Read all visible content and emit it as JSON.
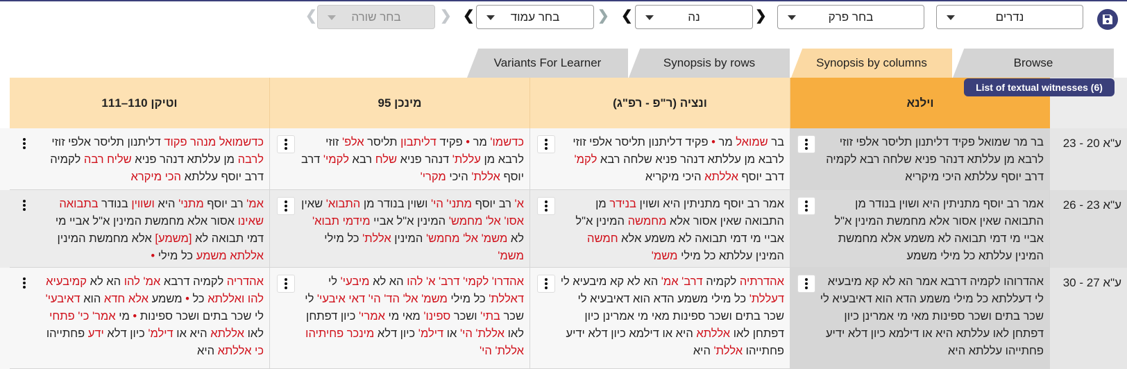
{
  "toolbar": {
    "save_icon": "save-icon",
    "tractate": "נדרים",
    "chapter_placeholder": "בחר פרק",
    "chapter_value": "נה",
    "page_placeholder": "בחר עמוד",
    "line_placeholder": "בחר שורה"
  },
  "tabs": {
    "browse": "Browse",
    "synopsis_columns": "Synopsis by columns",
    "synopsis_rows": "Synopsis by rows",
    "variants": "Variants For Learner"
  },
  "witness_button": "List of textual witnesses (6)",
  "columns": {
    "vilna": "וילנא",
    "venice": "ונציה (ר\"פ - רפ\"ג)",
    "munich": "מינכן 95",
    "vatican": "וטיקן 110–111"
  },
  "rows": [
    {
      "ref": "ע\"א 20 - 23",
      "vilna": [
        {
          "t": "בר מר שמואל פקיד דליתנון תליסר אלפי זוזי לרבא מן עללתא דנהר פניא שלחה רבא לקמיה דרב יוסף עללתא היכי מיקריא"
        }
      ],
      "venice": [
        {
          "t": "בר "
        },
        {
          "t": "שמואל",
          "v": true
        },
        {
          "t": " מר "
        },
        {
          "t": "•",
          "v": true
        },
        {
          "t": " פקיד דליתנון תליסר אלפי זוזי לרבא מן עללתא דנהר פניא שלחה רבא "
        },
        {
          "t": "לקמ'",
          "v": true
        },
        {
          "t": " דרב יוסף "
        },
        {
          "t": "אללתא",
          "v": true
        },
        {
          "t": " היכי מיקריא"
        }
      ],
      "munich": [
        {
          "t": "כדשמו'",
          "v": true
        },
        {
          "t": " מר "
        },
        {
          "t": "•",
          "v": true
        },
        {
          "t": " פקיד "
        },
        {
          "t": "דליתבון",
          "v": true
        },
        {
          "t": " תליסר "
        },
        {
          "t": "אלפ'",
          "v": true
        },
        {
          "t": " זוזי לרבא מן "
        },
        {
          "t": "עללת'",
          "v": true
        },
        {
          "t": " דנהר פניא "
        },
        {
          "t": "שלח",
          "v": true
        },
        {
          "t": " רבא "
        },
        {
          "t": "לקמי'",
          "v": true
        },
        {
          "t": " דרב יוסף "
        },
        {
          "t": "אללת'",
          "v": true
        },
        {
          "t": " היכי "
        },
        {
          "t": "מקרי'",
          "v": true
        }
      ],
      "vatican": [
        {
          "t": "כדשמואל מנהר פקוד",
          "v": true
        },
        {
          "t": " דליתנון תליסר אלפי זוזי "
        },
        {
          "t": "לרבה",
          "v": true
        },
        {
          "t": " מן עללתא דנהר פניא "
        },
        {
          "t": "שליח רבה",
          "v": true
        },
        {
          "t": " לקמיה דרב יוסף עללתא "
        },
        {
          "t": "הכי מיקרא",
          "v": true
        }
      ]
    },
    {
      "ref": "ע\"א 23 - 26",
      "vilna": [
        {
          "t": "אמר רב יוסף מתניתין היא ושוין בנודר מן התבואה שאין אסור אלא מחמשת המינין א\"ל אביי מי דמי תבואה לא משמע אלא מחמשת המינין עללתא כל מילי משמע"
        }
      ],
      "venice": [
        {
          "t": "אמר רב יוסף מתניתין היא ושוין "
        },
        {
          "t": "בנידר",
          "v": true
        },
        {
          "t": " מן התבואה שאין אסור אלא "
        },
        {
          "t": "מחמשה",
          "v": true
        },
        {
          "t": " המינין א\"ל אביי מי דמי תבואה לא משמע אלא "
        },
        {
          "t": "חמשה",
          "v": true
        },
        {
          "t": " המינין עללתא כל מילי "
        },
        {
          "t": "משמ'",
          "v": true
        }
      ],
      "munich": [
        {
          "t": "א'",
          "v": true
        },
        {
          "t": " רב יוסף "
        },
        {
          "t": "מתני' הי'",
          "v": true
        },
        {
          "t": " ושוין בנודר מן "
        },
        {
          "t": "התבוא'",
          "v": true
        },
        {
          "t": " שאין "
        },
        {
          "t": "אסו' אל' מחמש'",
          "v": true
        },
        {
          "t": " המינין א\"ל אביי "
        },
        {
          "t": "מידמי תבוא'",
          "v": true
        },
        {
          "t": " לא "
        },
        {
          "t": "משמ' אל' מחמש'",
          "v": true
        },
        {
          "t": " המינין "
        },
        {
          "t": "אללת'",
          "v": true
        },
        {
          "t": " כל מילי "
        },
        {
          "t": "משמ'",
          "v": true
        }
      ],
      "vatican": [
        {
          "t": "אמ'",
          "v": true
        },
        {
          "t": " רב יוסף "
        },
        {
          "t": "מתני'",
          "v": true
        },
        {
          "t": " היא "
        },
        {
          "t": "ושווין",
          "v": true
        },
        {
          "t": " בנודר "
        },
        {
          "t": "בתבואה שאינו",
          "v": true
        },
        {
          "t": " אסור אלא מחמשת המינין א\"ל אביי מי דמי תבואה לא "
        },
        {
          "t": "[משמע]",
          "v": true
        },
        {
          "t": " אלא מחמשת המינין "
        },
        {
          "t": "אללתא משמע",
          "v": true
        },
        {
          "t": " כל מילי "
        },
        {
          "t": "•",
          "v": true
        }
      ]
    },
    {
      "ref": "ע\"א 27 - 30",
      "vilna": [
        {
          "t": "אהדרוהו לקמיה דרבא אמר הא לא קא מיבעיא לי דעללתא כל מילי משמע הדא הוא דאיבעיא לי שכר בתים ושכר ספינות מאי מי אמרינן כיון דפתחן לאו עללתא היא או דילמא כיון דלא ידיע פחתייהו עללתא היא"
        }
      ],
      "venice": [
        {
          "t": "אהדרתיה",
          "v": true
        },
        {
          "t": " לקמיה "
        },
        {
          "t": "דרב' אמ'",
          "v": true
        },
        {
          "t": " הא לא קא מיבעיא לי "
        },
        {
          "t": "דעללת'",
          "v": true
        },
        {
          "t": " כל מילי משמע הדא הוא דאיבעיא לי שכר בתים ושכר ספינות מאי מי אמרינן כיון דפתחן לאו "
        },
        {
          "t": "אללתא",
          "v": true
        },
        {
          "t": " היא או דילמא כיון דלא ידיע פחתייהו "
        },
        {
          "t": "אללת'",
          "v": true
        },
        {
          "t": " היא"
        }
      ],
      "munich": [
        {
          "t": "אהדרו' לקמי' דרב' א' להו",
          "v": true
        },
        {
          "t": " הא לא "
        },
        {
          "t": "מיבעי'",
          "v": true
        },
        {
          "t": " לי "
        },
        {
          "t": "דאללת'",
          "v": true
        },
        {
          "t": " כל מילי "
        },
        {
          "t": "משמ' אל' הד' הי' דאי איבעי'",
          "v": true
        },
        {
          "t": " לי שכר "
        },
        {
          "t": "בתי'",
          "v": true
        },
        {
          "t": " ושכר "
        },
        {
          "t": "ספינו'",
          "v": true
        },
        {
          "t": " מאי מי "
        },
        {
          "t": "אמרי'",
          "v": true
        },
        {
          "t": " כיון דפתחן לאו "
        },
        {
          "t": "אללת' הי'",
          "v": true
        },
        {
          "t": " או "
        },
        {
          "t": "דילמ'",
          "v": true
        },
        {
          "t": " כיון דלא "
        },
        {
          "t": "מינכר פחיתיהו אללת' הי'",
          "v": true
        }
      ],
      "vatican": [
        {
          "t": "אהדריה",
          "v": true
        },
        {
          "t": " לקמיה דרבא "
        },
        {
          "t": "אמ' להו",
          "v": true
        },
        {
          "t": " הא לא "
        },
        {
          "t": "קמיבעיא להו ואללתא",
          "v": true
        },
        {
          "t": " כל "
        },
        {
          "t": "•",
          "v": true
        },
        {
          "t": " משמע "
        },
        {
          "t": "אלא חדא",
          "v": true
        },
        {
          "t": " הוא "
        },
        {
          "t": "דאיבעי'",
          "v": true
        },
        {
          "t": " לי שכר בתים ושכר ספינות "
        },
        {
          "t": "•",
          "v": true
        },
        {
          "t": " מי "
        },
        {
          "t": "אמר' כי' פתחי",
          "v": true
        },
        {
          "t": " לאו "
        },
        {
          "t": "אללתא",
          "v": true
        },
        {
          "t": " היא או "
        },
        {
          "t": "דילמ'",
          "v": true
        },
        {
          "t": " כיון דלא "
        },
        {
          "t": "ידע",
          "v": true
        },
        {
          "t": " פחתייהו "
        },
        {
          "t": "כי אללתא",
          "v": true
        },
        {
          "t": " היא"
        }
      ]
    }
  ],
  "colors": {
    "accent": "#3a3f7a",
    "variant": "#d0101a",
    "main_header": "#f7ae40",
    "header": "#fde1b3",
    "active_tab": "#fbd9a3"
  }
}
